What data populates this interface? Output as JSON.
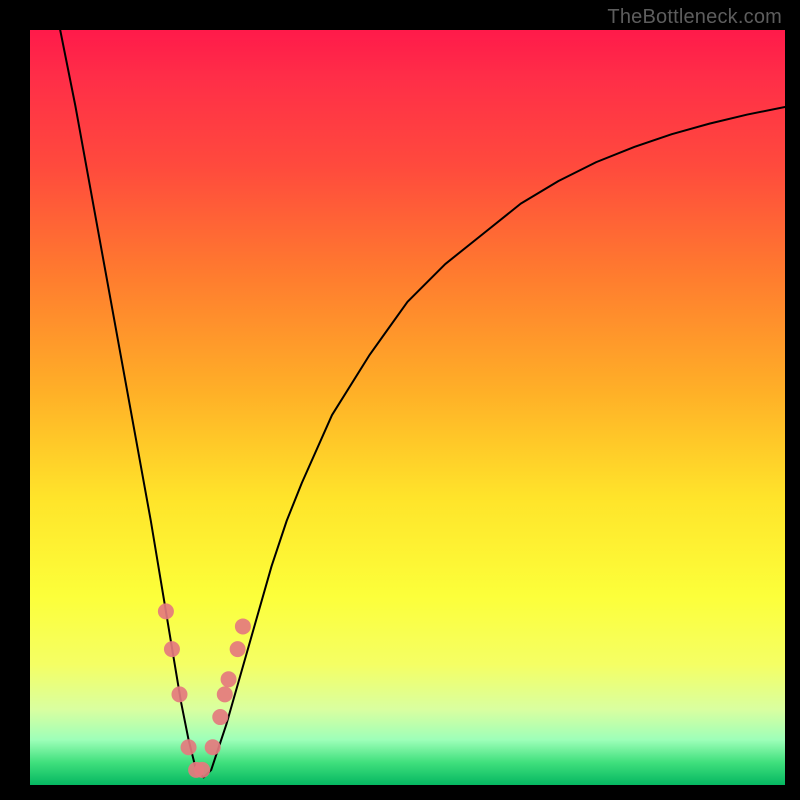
{
  "watermark": "TheBottleneck.com",
  "chart_data": {
    "type": "line",
    "title": "",
    "xlabel": "",
    "ylabel": "",
    "xlim": [
      0,
      100
    ],
    "ylim": [
      0,
      100
    ],
    "grid": false,
    "legend": false,
    "notes": "V-shaped curve on vertical red→green gradient (bottleneck mismatch chart). Minimum of V is near x≈22. Values are bottleneck % (0 at bottom = balanced, 100 at top = severe bottleneck). Axes unlabeled in image.",
    "series": [
      {
        "name": "bottleneck-curve",
        "x": [
          4,
          6,
          8,
          10,
          12,
          14,
          16,
          18,
          19,
          20,
          21,
          22,
          23,
          24,
          25,
          26,
          28,
          30,
          32,
          34,
          36,
          40,
          45,
          50,
          55,
          60,
          65,
          70,
          75,
          80,
          85,
          90,
          95,
          100
        ],
        "values": [
          100,
          90,
          79,
          68,
          57,
          46,
          35,
          23,
          17,
          11,
          6,
          2,
          1,
          2,
          5,
          8,
          15,
          22,
          29,
          35,
          40,
          49,
          57,
          64,
          69,
          73,
          77,
          80,
          82.5,
          84.5,
          86.2,
          87.6,
          88.8,
          89.8
        ]
      }
    ],
    "markers": {
      "name": "highlighted-points",
      "style": "salmon-dot",
      "x": [
        18,
        18.8,
        19.8,
        21,
        22,
        22.8,
        24.2,
        25.2,
        25.8,
        26.3,
        27.5,
        28.2
      ],
      "values": [
        23,
        18,
        12,
        5,
        2,
        2,
        5,
        9,
        12,
        14,
        18,
        21
      ]
    }
  }
}
